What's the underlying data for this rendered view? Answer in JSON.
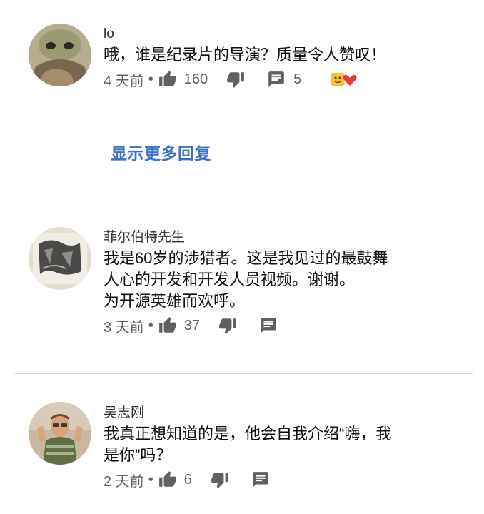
{
  "comments": [
    {
      "author": "lo",
      "text": "哦，谁是纪录片的导演？质量令人赞叹！",
      "time": "4 天前",
      "likes": "160",
      "replies": "5"
    },
    {
      "author": "菲尔伯特先生",
      "text": "我是60岁的涉猎者。这是我见过的最鼓舞\n人心的开发和开发人员视频。谢谢。\n为开源英雄而欢呼。",
      "time": "3 天前",
      "likes": "37"
    },
    {
      "author": "吴志刚",
      "text": "我真正想知道的是，他会自我介绍“嗨，我\n是你”吗？",
      "time": "2 天前",
      "likes": "6"
    }
  ],
  "show_more_replies": "显示更多回复",
  "colors": {
    "accent": "#3a73c4",
    "meta": "#606060",
    "heart": "#e53935"
  },
  "icons": [
    "thumbs-up-icon",
    "thumbs-down-icon",
    "reply-icon",
    "creator-heart-icon"
  ]
}
